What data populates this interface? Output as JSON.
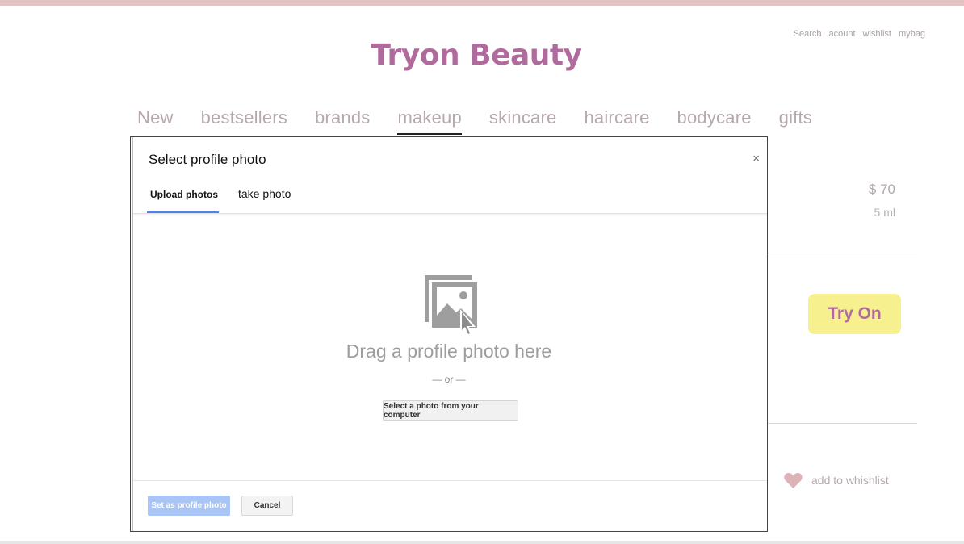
{
  "site": {
    "brand": "Tryon Beauty",
    "util_links": [
      "Search",
      "acount",
      "wishlist",
      "mybag"
    ],
    "nav": [
      "New",
      "bestsellers",
      "brands",
      "makeup",
      "skincare",
      "haircare",
      "bodycare",
      "gifts"
    ],
    "active_nav": "makeup"
  },
  "product": {
    "price": "$ 70",
    "size": "5 ml",
    "try_on_label": "Try On",
    "wishlist_label": "add to whishlist"
  },
  "modal": {
    "title": "Select profile photo",
    "close_glyph": "×",
    "tabs": [
      {
        "label": "Upload photos",
        "active": true
      },
      {
        "label": "take photo",
        "active": false
      }
    ],
    "drop_text": "Drag a profile photo here",
    "or_text": "— or —",
    "select_button": "Select a photo from your computer",
    "set_button": "Set as profile photo",
    "cancel_button": "Cancel"
  },
  "colors": {
    "brand": "#b06b9d",
    "top_bar": "#e2c4c5",
    "try_on_bg": "#f6f08f",
    "tab_underline": "#4e86e8",
    "set_button_bg": "#a8c5f5",
    "heart": "#dcb3b7"
  },
  "icons": {
    "drop_photo": "image-drop-icon",
    "heart": "heart-icon",
    "close": "close-icon"
  }
}
